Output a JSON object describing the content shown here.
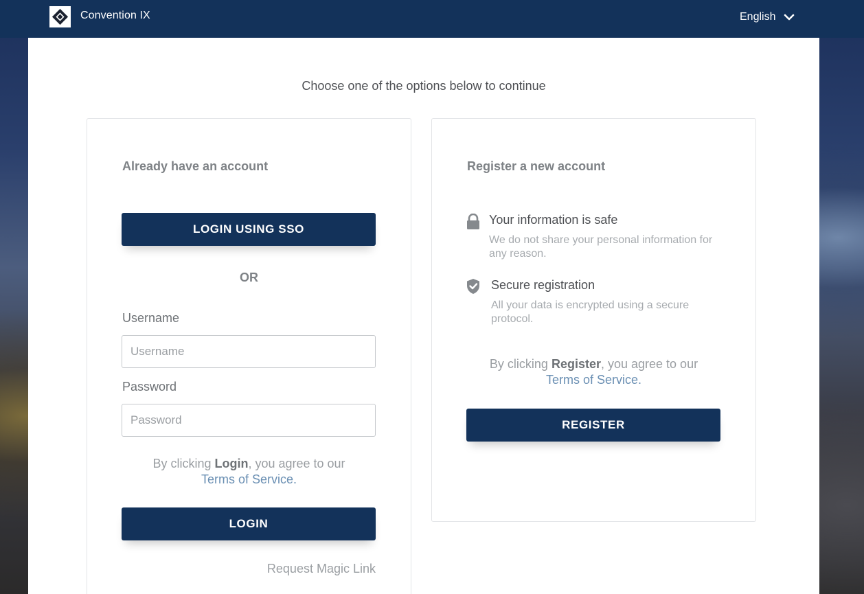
{
  "header": {
    "brand_name": "Convention IX",
    "language": "English"
  },
  "main": {
    "intro": "Choose one of the options below to continue"
  },
  "login_card": {
    "title": "Already have an account",
    "sso_button": "LOGIN USING SSO",
    "or_text": "OR",
    "username_label": "Username",
    "username_placeholder": "Username",
    "username_value": "",
    "password_label": "Password",
    "password_placeholder": "Password",
    "password_value": "",
    "terms_prefix": "By clicking ",
    "terms_action": "Login",
    "terms_middle": ", you agree to our",
    "terms_link": "Terms of Service.",
    "login_button": "LOGIN",
    "magic_link": "Request Magic Link"
  },
  "register_card": {
    "title": "Register a new account",
    "features": [
      {
        "icon": "lock-icon",
        "title": "Your information is safe",
        "description": "We do not share your personal information for any reason."
      },
      {
        "icon": "shield-check-icon",
        "title": "Secure registration",
        "description": "All your data is encrypted using a secure protocol."
      }
    ],
    "terms_prefix": "By clicking ",
    "terms_action": "Register",
    "terms_middle": ", you agree to our",
    "terms_link": "Terms of Service.",
    "register_button": "REGISTER"
  },
  "colors": {
    "header_bg": "#13325a",
    "button_bg": "#13325a",
    "link": "#6a8fb3",
    "muted_text": "#9a9ea2"
  }
}
